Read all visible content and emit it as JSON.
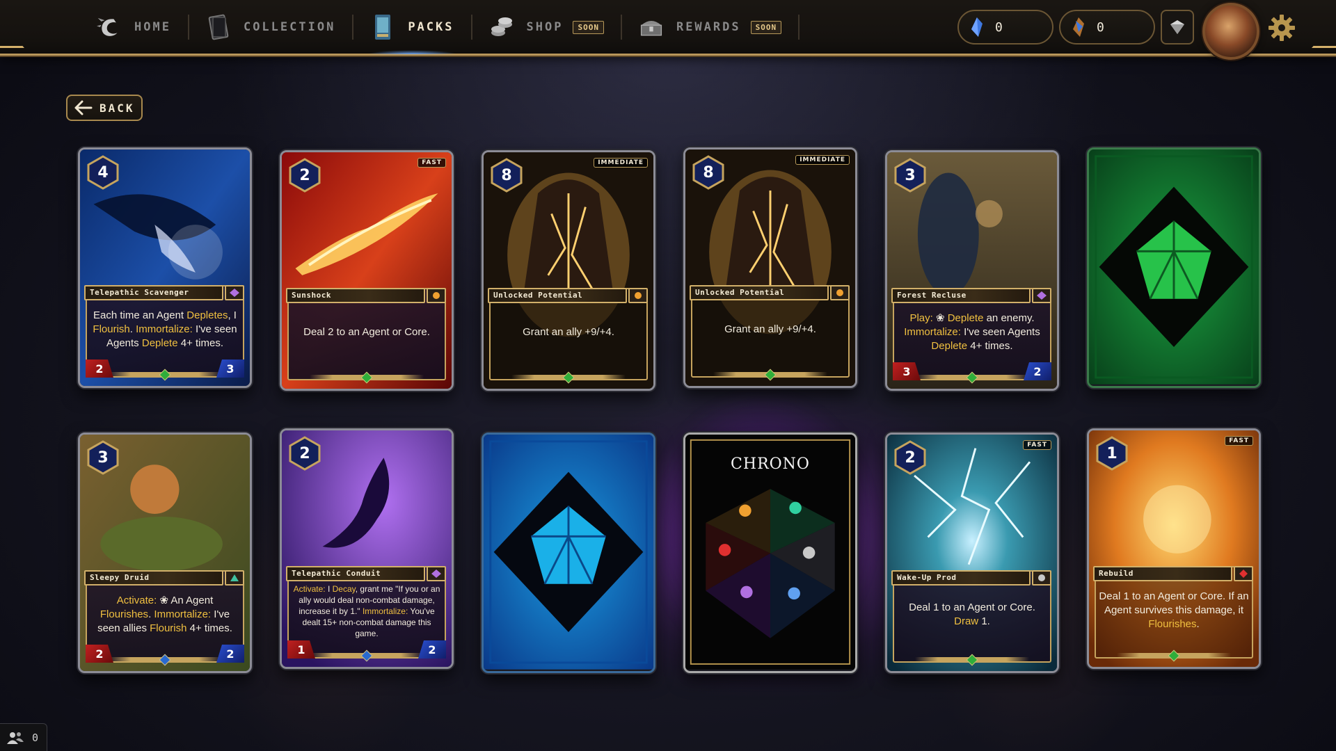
{
  "nav": {
    "items": [
      {
        "label": "HOME",
        "icon": "dragon-logo-icon",
        "active": false
      },
      {
        "label": "COLLECTION",
        "icon": "card-book-icon",
        "active": false
      },
      {
        "label": "PACKS",
        "icon": "card-pack-icon",
        "active": true
      },
      {
        "label": "SHOP",
        "icon": "coins-icon",
        "active": false,
        "badge": "SOON"
      },
      {
        "label": "REWARDS",
        "icon": "chest-icon",
        "active": false,
        "badge": "SOON"
      }
    ]
  },
  "currencies": [
    {
      "icon": "blue-shard-icon",
      "value": "0"
    },
    {
      "icon": "bronze-shard-icon",
      "value": "0"
    }
  ],
  "back_label": "BACK",
  "players_online": "0",
  "colors": {
    "gold": "#c6a45e",
    "keyword": "#f0c040",
    "attack": "#c02020",
    "health": "#2a4fd0",
    "green_back": "#0f6a2a",
    "blue_back": "#0b5aa8",
    "purple_glow": "#b046ff"
  },
  "cards": [
    {
      "name": "Telepathic Scavenger",
      "cost": "4",
      "speed": "",
      "attack": "2",
      "health": "3",
      "rules": [
        {
          "t": "Each time an Agent "
        },
        {
          "t": "Depletes",
          "k": true
        },
        {
          "t": ", I "
        },
        {
          "t": "Flourish",
          "k": true
        },
        {
          "t": ". "
        },
        {
          "t": "Immortalize:",
          "k": true
        },
        {
          "t": " I've seen Agents "
        },
        {
          "t": "Deplete",
          "k": true
        },
        {
          "t": " 4+ times."
        }
      ]
    },
    {
      "name": "Sunshock",
      "cost": "2",
      "speed": "FAST",
      "attack": "",
      "health": "",
      "rules": [
        {
          "t": "Deal 2 to an Agent or Core."
        }
      ]
    },
    {
      "name": "Unlocked Potential",
      "cost": "8",
      "speed": "IMMEDIATE",
      "attack": "",
      "health": "",
      "rules": [
        {
          "t": "Grant an ally +9/+4."
        }
      ]
    },
    {
      "name": "Unlocked Potential",
      "cost": "8",
      "speed": "IMMEDIATE",
      "attack": "",
      "health": "",
      "rules": [
        {
          "t": "Grant an ally +9/+4."
        }
      ]
    },
    {
      "name": "Forest Recluse",
      "cost": "3",
      "speed": "",
      "attack": "3",
      "health": "2",
      "rules": [
        {
          "t": "Play:",
          "k": true
        },
        {
          "t": " ❀ "
        },
        {
          "t": "Deplete",
          "k": true
        },
        {
          "t": " an enemy. "
        },
        {
          "t": "Immortalize:",
          "k": true
        },
        {
          "t": " I've seen Agents "
        },
        {
          "t": "Deplete",
          "k": true
        },
        {
          "t": " 4+ times."
        }
      ]
    },
    {
      "back": "green"
    },
    {
      "name": "Sleepy Druid",
      "cost": "3",
      "speed": "",
      "attack": "2",
      "health": "2",
      "rules": [
        {
          "t": "Activate:",
          "k": true
        },
        {
          "t": " ❀ An Agent "
        },
        {
          "t": "Flourishes",
          "k": true
        },
        {
          "t": ". "
        },
        {
          "t": "Immortalize:",
          "k": true
        },
        {
          "t": " I've seen allies "
        },
        {
          "t": "Flourish",
          "k": true
        },
        {
          "t": " 4+ times."
        }
      ]
    },
    {
      "name": "Telepathic Conduit",
      "cost": "2",
      "speed": "",
      "attack": "1",
      "health": "2",
      "small": true,
      "rules": [
        {
          "t": "Activate:",
          "k": true
        },
        {
          "t": " I "
        },
        {
          "t": "Decay",
          "k": true
        },
        {
          "t": ", grant me \"If you or an ally would deal non-combat damage, increase it by 1.\" "
        },
        {
          "t": "Immortalize:",
          "k": true
        },
        {
          "t": " You've dealt 15+ non-combat damage this game."
        }
      ]
    },
    {
      "back": "blue"
    },
    {
      "back": "chrono",
      "title": "CHRONO"
    },
    {
      "name": "Wake-Up Prod",
      "cost": "2",
      "speed": "FAST",
      "attack": "",
      "health": "",
      "rules": [
        {
          "t": "Deal 1 to an Agent or Core. "
        },
        {
          "t": "Draw",
          "k": true
        },
        {
          "t": " 1."
        }
      ]
    },
    {
      "name": "Rebuild",
      "cost": "1",
      "speed": "FAST",
      "attack": "",
      "health": "",
      "rules": [
        {
          "t": "Deal 1 to an Agent or Core. If an Agent survives this damage, it "
        },
        {
          "t": "Flourishes",
          "k": true
        },
        {
          "t": "."
        }
      ]
    }
  ]
}
